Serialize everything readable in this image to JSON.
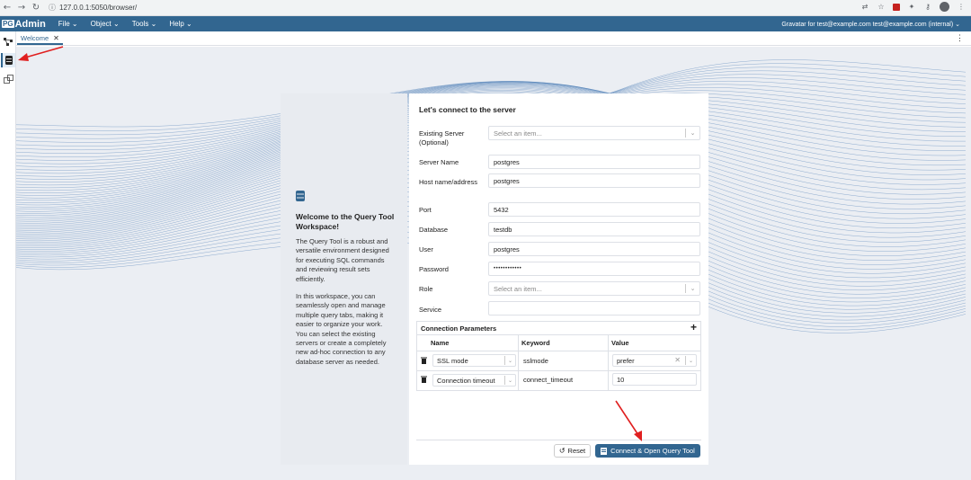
{
  "browser": {
    "url": "127.0.0.1:5050/browser/"
  },
  "app": {
    "logo_pg": "PG",
    "logo_text": "Admin",
    "menu": [
      "File",
      "Object",
      "Tools",
      "Help"
    ],
    "user": "Gravatar for test@example.com test@example.com (internal)"
  },
  "tabs": {
    "welcome": "Welcome"
  },
  "welcome": {
    "title": "Welcome to the Query Tool Workspace!",
    "p1": "The Query Tool is a robust and versatile environment designed for executing SQL commands and reviewing result sets efficiently.",
    "p2": "In this workspace, you can seamlessly open and manage multiple query tabs, making it easier to organize your work. You can select the existing servers or create a completely new ad-hoc connection to any database server as needed."
  },
  "form": {
    "title": "Let's connect to the server",
    "existing_server_label": "Existing Server (Optional)",
    "existing_server_placeholder": "Select an item...",
    "server_name_label": "Server Name",
    "server_name_value": "postgres",
    "host_label": "Host name/address",
    "host_value": "postgres",
    "port_label": "Port",
    "port_value": "5432",
    "database_label": "Database",
    "database_value": "testdb",
    "user_label": "User",
    "user_value": "postgres",
    "password_label": "Password",
    "password_value": "••••••••••••",
    "role_label": "Role",
    "role_placeholder": "Select an item...",
    "service_label": "Service",
    "service_value": ""
  },
  "conn_params": {
    "title": "Connection Parameters",
    "col_name": "Name",
    "col_keyword": "Keyword",
    "col_value": "Value",
    "rows": [
      {
        "name": "SSL mode",
        "keyword": "sslmode",
        "value": "prefer"
      },
      {
        "name": "Connection timeout",
        "keyword": "connect_timeout",
        "value": "10"
      }
    ]
  },
  "buttons": {
    "reset": "Reset",
    "connect": "Connect & Open Query Tool"
  },
  "colors": {
    "brand": "#326690",
    "wave": "#3f74b0",
    "annotation": "#e02020"
  }
}
